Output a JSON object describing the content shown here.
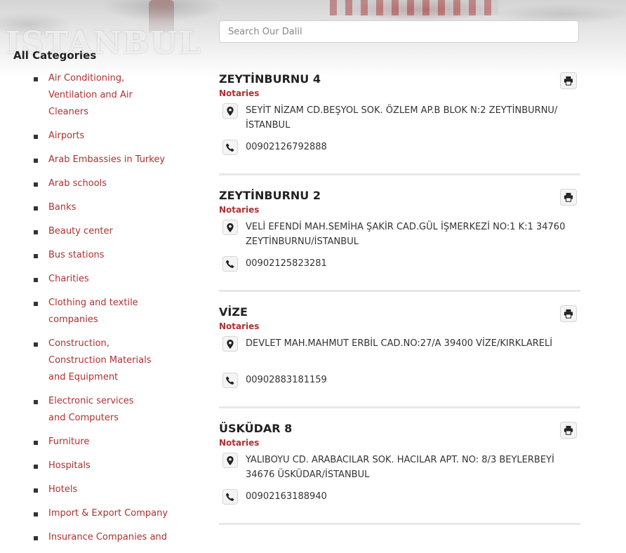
{
  "search": {
    "placeholder": "Search Our Dalil"
  },
  "sidebar": {
    "title": "All Categories",
    "items": [
      "Air Conditioning, Ventilation and Air Cleaners",
      "Airports",
      "Arab Embassies in Turkey",
      "Arab schools",
      "Banks",
      "Beauty center",
      "Bus stations",
      "Charities",
      "Clothing and textile companies",
      "Construction, Construction Materials and Equipment",
      "Electronic services and Computers",
      "Furniture",
      "Hospitals",
      "Hotels",
      "Import & Export Company",
      "Insurance Companies and"
    ]
  },
  "listings": [
    {
      "title": "ZEYTİNBURNU 4",
      "category": "Notaries",
      "address": "SEYİT NİZAM CD.BEŞYOL SOK. ÖZLEM AP.B BLOK N:2 ZEYTİNBURNU/İSTANBUL",
      "phone": "00902126792888"
    },
    {
      "title": "ZEYTİNBURNU 2",
      "category": "Notaries",
      "address": "VELİ EFENDİ MAH.SEMİHA ŞAKİR CAD.GÜL İŞMERKEZİ NO:1 K:1 34760 ZEYTİNBURNU/İSTANBUL",
      "phone": "00902125823281"
    },
    {
      "title": "VİZE",
      "category": "Notaries",
      "address": "DEVLET MAH.MAHMUT ERBİL CAD.NO:27/A 39400 VİZE/KIRKLARELİ",
      "phone": "00902883181159"
    },
    {
      "title": "ÜSKÜDAR 8",
      "category": "Notaries",
      "address": "YALIBOYU CD. ARABACILAR SOK. HACILAR APT. NO: 8/3 BEYLERBEYİ 34676 ÜSKÜDAR/İSTANBUL",
      "phone": "00902163188940"
    }
  ],
  "icons": {
    "address": "map-marker-icon",
    "phone": "phone-icon",
    "print": "print-icon"
  },
  "colors": {
    "accent": "#b03030"
  }
}
